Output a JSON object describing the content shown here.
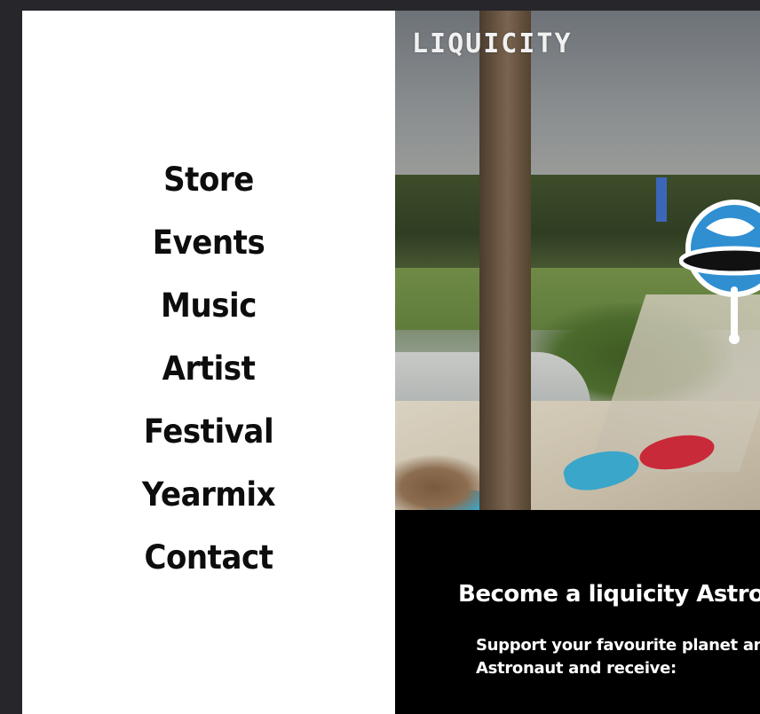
{
  "nav": {
    "items": [
      {
        "label": "Store"
      },
      {
        "label": "Events"
      },
      {
        "label": "Music"
      },
      {
        "label": "Artist"
      },
      {
        "label": "Festival"
      },
      {
        "label": "Yearmix"
      },
      {
        "label": "Contact"
      }
    ]
  },
  "hero": {
    "logo_text": "LIQUICITY",
    "badge_icon": "astronaut-globe-icon"
  },
  "promo": {
    "title": "Become a liquicity Astrona",
    "line1": "Support your favourite planet and its",
    "line2": "Astronaut and receive:"
  }
}
